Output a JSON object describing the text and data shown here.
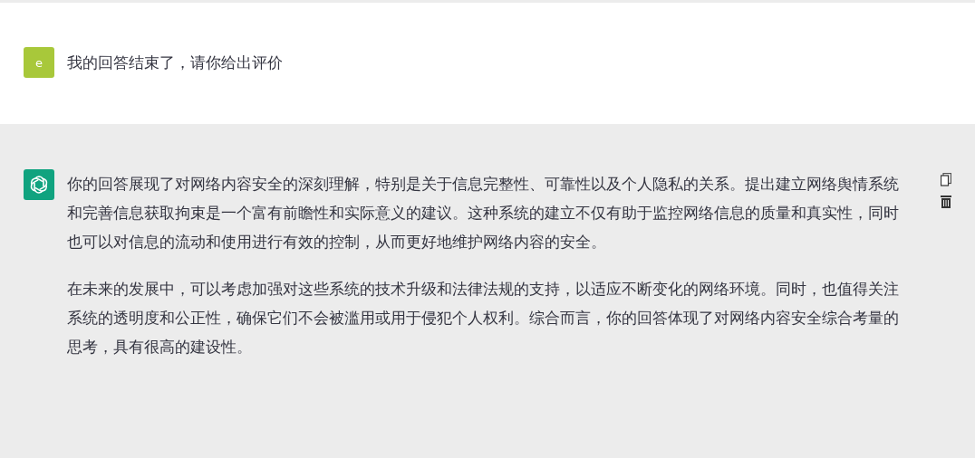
{
  "messages": [
    {
      "kind": "user",
      "avatar": "e",
      "paragraphs": [
        "我的回答结束了，请你给出评价"
      ]
    },
    {
      "kind": "assistant",
      "paragraphs": [
        "你的回答展现了对网络内容安全的深刻理解，特别是关于信息完整性、可靠性以及个人隐私的关系。提出建立网络舆情系统和完善信息获取拘束是一个富有前瞻性和实际意义的建议。这种系统的建立不仅有助于监控网络信息的质量和真实性，同时也可以对信息的流动和使用进行有效的控制，从而更好地维护网络内容的安全。",
        "在未来的发展中，可以考虑加强对这些系统的技术升级和法律法规的支持，以适应不断变化的网络环境。同时，也值得关注系统的透明度和公正性，确保它们不会被滥用或用于侵犯个人权利。综合而言，你的回答体现了对网络内容安全综合考量的思考，具有很高的建设性。"
      ]
    }
  ]
}
